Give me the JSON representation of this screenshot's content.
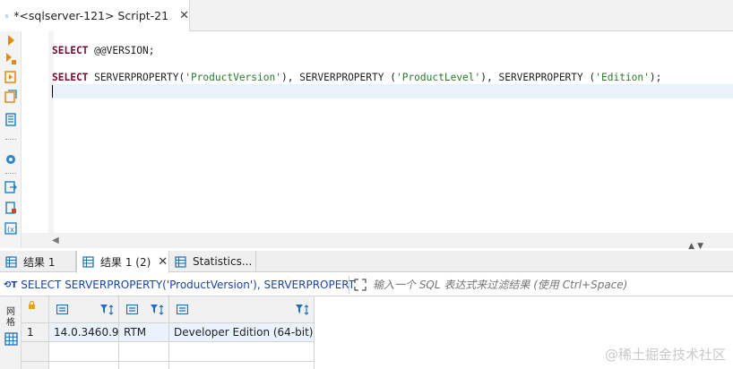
{
  "editor_tab": {
    "title": "*<sqlserver-121> Script-21",
    "close": "✕"
  },
  "gutter_icons": [
    "execute-statement-icon",
    "execute-script-icon",
    "execute-in-new-tab-icon",
    "explain-plan-icon",
    "load-execution-plan-icon",
    "settings-icon",
    "export-icon",
    "file-export-icon",
    "variables-icon"
  ],
  "editor": {
    "lines": [
      {
        "segments": [
          {
            "t": "SELECT ",
            "c": "kw"
          },
          {
            "t": "@@VERSION;",
            "c": "txt"
          }
        ]
      },
      {
        "segments": [
          {
            "t": "SELECT ",
            "c": "kw"
          },
          {
            "t": "SERVERPROPERTY(",
            "c": "txt"
          },
          {
            "t": "'ProductVersion'",
            "c": "str"
          },
          {
            "t": "), SERVERPROPERTY (",
            "c": "txt"
          },
          {
            "t": "'ProductLevel'",
            "c": "str"
          },
          {
            "t": "), SERVERPROPERTY (",
            "c": "txt"
          },
          {
            "t": "'Edition'",
            "c": "str"
          },
          {
            "t": ");",
            "c": "txt"
          }
        ]
      }
    ],
    "scroll_left": "◀",
    "nav_arrows": "▲▼"
  },
  "result_tabs": [
    {
      "label": "结果 1",
      "active": false
    },
    {
      "label": "结果 1 (2)",
      "active": true,
      "close": "✕"
    },
    {
      "label": "Statistics...",
      "active": false
    }
  ],
  "filter": {
    "query_icon": "⟲T",
    "query": "SELECT SERVERPROPERTY('ProductVersion'), SERVERPROPERT",
    "placeholder": "输入一个 SQL 表达式来过滤结果 (使用 Ctrl+Space)"
  },
  "results_gutter": {
    "vertical_label": "网格"
  },
  "grid": {
    "rows": [
      {
        "num": "1",
        "cells": [
          "14.0.3460.9",
          "RTM",
          "Developer Edition (64-bit)"
        ]
      }
    ]
  },
  "watermark": "@稀土掘金技术社区",
  "colors": {
    "keyword": "#7a0a2c",
    "string": "#2a7a2a",
    "selection": "#eaf2fc",
    "link_blue": "#1a44a6"
  }
}
